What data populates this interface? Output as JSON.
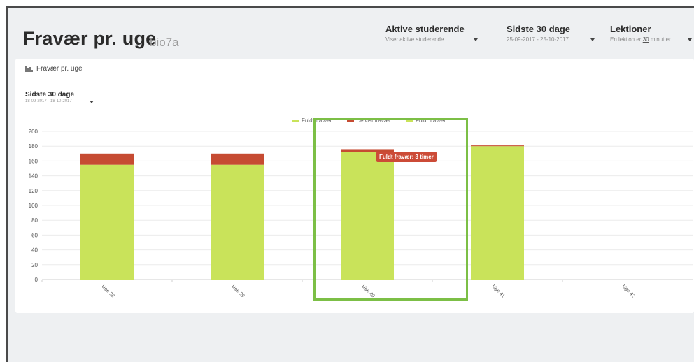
{
  "header": {
    "title": "Fravær pr. uge",
    "subtitle": "bio7a"
  },
  "filters": [
    {
      "title": "Aktive studerende",
      "sub": "Viser aktive studerende"
    },
    {
      "title": "Sidste 30 dage",
      "sub": "25-09-2017 - 25-10-2017"
    },
    {
      "title": "Lektioner",
      "sub_prefix": "En lektion er ",
      "sub_value": "30",
      "sub_suffix": " minutter"
    }
  ],
  "card": {
    "title": "Fravær pr. uge",
    "icon": "bar-chart-icon"
  },
  "range": {
    "title": "Sidste 30 dage",
    "sub": "18-09-2017 - 18-10-2017"
  },
  "legend": [
    {
      "label": "Fuldt fravær",
      "color": "#c9e35a"
    },
    {
      "label": "Delvist fravær",
      "color": "#c64b32"
    },
    {
      "label": "Fuldt fravær",
      "color": "#c9e35a"
    }
  ],
  "tooltip": "Fuldt fravær: 3 timer",
  "chart_data": {
    "type": "bar",
    "stacked": true,
    "categories": [
      "Uge 38",
      "Uge 39",
      "Uge 40",
      "Uge 41",
      "Uge 42"
    ],
    "series": [
      {
        "name": "Fuldt fravær",
        "color": "#c9e35a",
        "values": [
          155,
          155,
          172,
          180,
          0
        ]
      },
      {
        "name": "Delvist fravær",
        "color": "#c64b32",
        "values": [
          15,
          15,
          4,
          1,
          0
        ]
      }
    ],
    "yticks": [
      0,
      20,
      40,
      60,
      80,
      100,
      120,
      140,
      160,
      180,
      200
    ],
    "ylim": [
      0,
      200
    ],
    "grid": true
  },
  "colors": {
    "accent_frame": "#7cbf46",
    "tooltip": "#cc4b37"
  }
}
